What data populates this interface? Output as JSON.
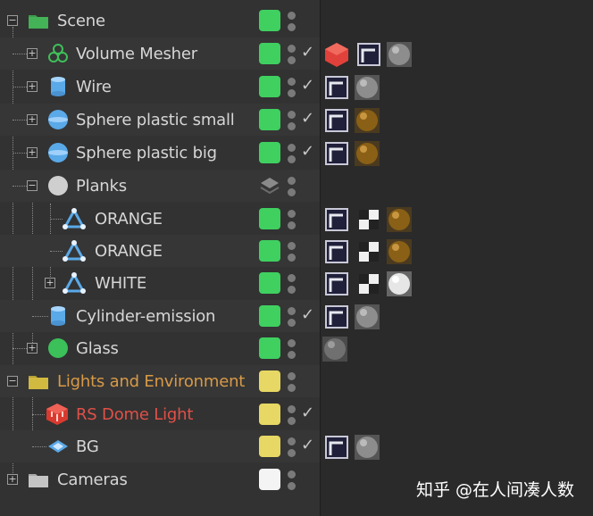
{
  "colors": {
    "visibility_green": "#3fd060",
    "visibility_yellow": "#e7d764",
    "visibility_white": "#f4f4f4",
    "lights_label": "#d89a47",
    "dome_label": "#e05048",
    "text": "#d6d6d6"
  },
  "rows": [
    {
      "label": "Scene",
      "icon": "folder-icon",
      "visibility": "green",
      "check": false
    },
    {
      "label": "Volume Mesher",
      "icon": "volume-mesher-icon",
      "visibility": "green",
      "check": true,
      "tags": [
        "redshift-object-tag",
        "phong-tag",
        "material-gray"
      ]
    },
    {
      "label": "Wire",
      "icon": "cylinder-icon",
      "visibility": "green",
      "check": true,
      "tags": [
        "phong-tag",
        "material-gray"
      ]
    },
    {
      "label": "Sphere plastic small",
      "icon": "sphere-icon",
      "visibility": "green",
      "check": true,
      "tags": [
        "phong-tag",
        "material-brown"
      ]
    },
    {
      "label": "Sphere plastic big",
      "icon": "sphere-icon",
      "visibility": "green",
      "check": true,
      "tags": [
        "phong-tag",
        "material-brown"
      ]
    },
    {
      "label": "Planks",
      "icon": "null-icon",
      "visibility": "layer",
      "check": false
    },
    {
      "label": "ORANGE",
      "icon": "polygon-object-icon",
      "visibility": "green",
      "check": false,
      "tags": [
        "phong-tag",
        "uvw-tag",
        "material-brown"
      ]
    },
    {
      "label": "ORANGE",
      "icon": "polygon-object-icon",
      "visibility": "green",
      "check": false,
      "tags": [
        "phong-tag",
        "uvw-tag",
        "material-brown"
      ]
    },
    {
      "label": "WHITE",
      "icon": "polygon-object-icon",
      "visibility": "green",
      "check": false,
      "tags": [
        "phong-tag",
        "uvw-tag",
        "material-white"
      ]
    },
    {
      "label": "Cylinder-emission",
      "icon": "cylinder-icon",
      "visibility": "green",
      "check": true,
      "tags": [
        "phong-tag",
        "material-gray"
      ]
    },
    {
      "label": "Glass",
      "icon": "sphere-green-icon",
      "visibility": "green",
      "check": false,
      "tags": [
        "material-glass"
      ]
    },
    {
      "label": "Lights and Environment",
      "icon": "folder-icon",
      "visibility": "yellow",
      "check": false
    },
    {
      "label": "RS Dome Light",
      "icon": "dome-light-icon",
      "visibility": "yellow",
      "check": true
    },
    {
      "label": "BG",
      "icon": "background-icon",
      "visibility": "yellow",
      "check": true,
      "tags": [
        "phong-tag",
        "material-gray"
      ]
    },
    {
      "label": "Cameras",
      "icon": "folder-icon",
      "visibility": "white",
      "check": false
    }
  ],
  "watermark": {
    "text": "知乎 @在人间凑人数"
  }
}
